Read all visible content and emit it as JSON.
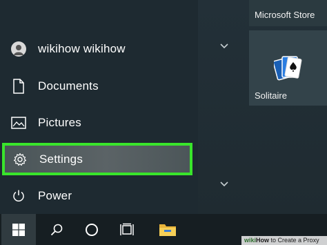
{
  "nav": {
    "user_label": "wikihow wikihow",
    "documents_label": "Documents",
    "pictures_label": "Pictures",
    "settings_label": "Settings",
    "power_label": "Power"
  },
  "tiles": {
    "store_label": "Microsoft Store",
    "solitaire_label": "Solitaire"
  },
  "icons": {
    "user": "avatar-icon",
    "documents": "document-icon",
    "pictures": "picture-icon",
    "settings": "gear-icon",
    "power": "power-icon",
    "start": "windows-logo-icon",
    "search": "search-icon",
    "cortana": "cortana-circle-icon",
    "taskview": "task-view-icon",
    "explorer": "folder-icon"
  },
  "colors": {
    "highlight": "#39e52b",
    "background": "#1f2a30",
    "taskbar": "#161e22"
  },
  "watermark": {
    "brand": "wiki",
    "how": "How",
    "title": "to Create a Proxy"
  }
}
